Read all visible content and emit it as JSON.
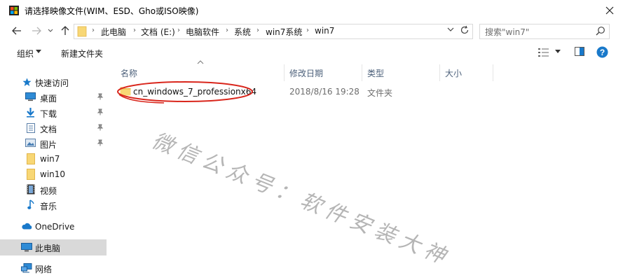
{
  "window": {
    "title": "请选择映像文件(WIM、ESD、Gho或ISO映像)",
    "app_icon": "windows-flag-icon"
  },
  "address": {
    "crumbs": [
      "此电脑",
      "文档 (E:)",
      "电脑软件",
      "系统",
      "win7系统",
      "win7"
    ],
    "search_placeholder": "搜索\"win7\""
  },
  "commands": {
    "organize": "组织",
    "new_folder": "新建文件夹"
  },
  "sidebar": {
    "quick_access": "快速访问",
    "items": [
      {
        "label": "桌面",
        "icon": "desktop-icon",
        "pinned": true
      },
      {
        "label": "下载",
        "icon": "download-icon",
        "pinned": true
      },
      {
        "label": "文档",
        "icon": "document-icon",
        "pinned": true
      },
      {
        "label": "图片",
        "icon": "pictures-icon",
        "pinned": true
      },
      {
        "label": "win7",
        "icon": "folder-icon",
        "pinned": false
      },
      {
        "label": "win10",
        "icon": "folder-icon",
        "pinned": false
      },
      {
        "label": "视频",
        "icon": "video-icon",
        "pinned": false
      },
      {
        "label": "音乐",
        "icon": "music-icon",
        "pinned": false
      }
    ],
    "onedrive": "OneDrive",
    "this_pc": "此电脑",
    "network": "网络"
  },
  "columns": [
    "名称",
    "修改日期",
    "类型",
    "大小"
  ],
  "files": [
    {
      "name": "cn_windows_7_professionx64",
      "date": "2018/8/16 19:28",
      "type": "文件夹",
      "size": ""
    }
  ],
  "watermark": "微信公众号：软件安装大神",
  "colors": {
    "folder_yellow": "#f8d775",
    "folder_dark": "#e8b84a",
    "annotation_red": "#d9261c",
    "header_text": "#4c607a",
    "selected_bg": "#d9d9d9",
    "accent_blue": "#1979ca"
  }
}
